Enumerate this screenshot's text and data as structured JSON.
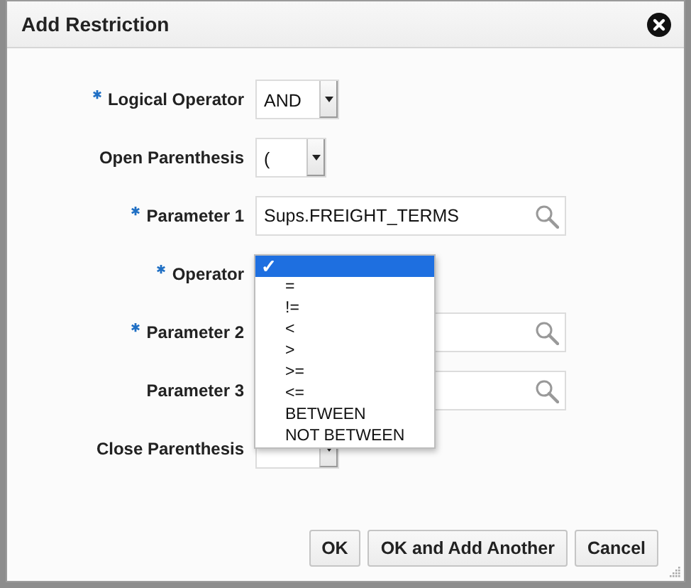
{
  "window": {
    "title": "Add Restriction"
  },
  "fields": [
    {
      "kind": "select",
      "label": "Logical Operator",
      "required": true,
      "value": "AND"
    },
    {
      "kind": "select",
      "label": "Open Parenthesis",
      "required": false,
      "value": "("
    },
    {
      "kind": "lov",
      "label": "Parameter 1",
      "required": true,
      "value": "Sups.FREIGHT_TERMS"
    },
    {
      "kind": "open-select",
      "label": "Operator",
      "required": true,
      "check": "✓",
      "options": [
        {
          "selected": true
        },
        {
          "label": "=",
          "selected": false
        },
        {
          "label": "!=",
          "selected": false
        },
        {
          "label": "<",
          "selected": false
        },
        {
          "label": ">",
          "selected": false
        },
        {
          "label": ">=",
          "selected": false
        },
        {
          "label": "<=",
          "selected": false
        },
        {
          "label": "BETWEEN",
          "selected": false
        },
        {
          "label": "NOT BETWEEN",
          "selected": false
        }
      ]
    },
    {
      "kind": "lov",
      "label": "Parameter 2",
      "required": true
    },
    {
      "kind": "lov",
      "label": "Parameter 3",
      "required": false
    },
    {
      "kind": "select",
      "label": "Close Parenthesis",
      "required": false
    }
  ],
  "buttons": [
    "OK",
    "OK and Add Another",
    "Cancel"
  ]
}
